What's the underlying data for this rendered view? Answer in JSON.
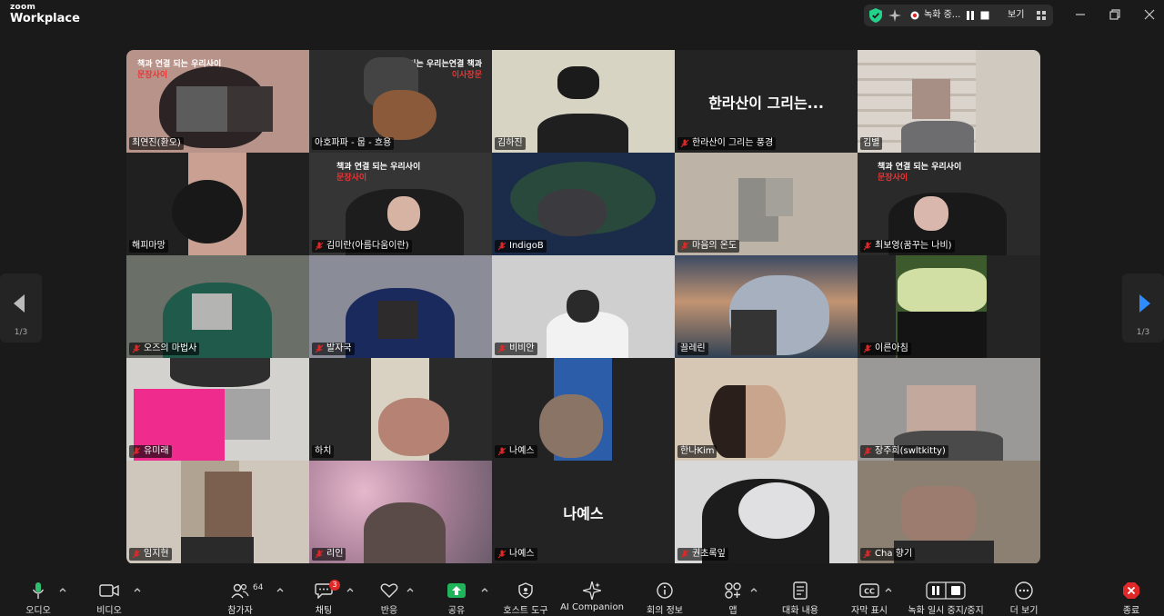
{
  "app": {
    "brand_small": "zoom",
    "brand_large": "Workplace"
  },
  "recording": {
    "status_text": "녹화 중...",
    "view_label": "보기"
  },
  "tiles": [
    {
      "name": "최연진(환오)",
      "muted": false,
      "bg": "#b8938a"
    },
    {
      "name": "아호파파 - 뭅 - 흐용",
      "muted": false,
      "bg": "#2c2c2c",
      "active": true
    },
    {
      "name": "김하진",
      "muted": false,
      "bg": "#d8d4c4"
    },
    {
      "name": "한라산이 그리는 풍경",
      "muted": true,
      "bg": "#232323",
      "big_label": "한라산이 그리는..."
    },
    {
      "name": "김별",
      "muted": false,
      "bg": "#cfc9c0"
    },
    {
      "name": "해피마망",
      "muted": false,
      "bg": "#202020"
    },
    {
      "name": "김미란(아름다움이란)",
      "muted": true,
      "bg": "#353535"
    },
    {
      "name": "IndigoB",
      "muted": true,
      "bg": "#1b2c4a"
    },
    {
      "name": "마음의 온도",
      "muted": true,
      "bg": "#bdb3a6"
    },
    {
      "name": "최보영(꿈꾸는 나비)",
      "muted": true,
      "bg": "#2a2a2a"
    },
    {
      "name": "오즈의 마법사",
      "muted": true,
      "bg": "#6a7068"
    },
    {
      "name": "발자국",
      "muted": true,
      "bg": "#8a8c98"
    },
    {
      "name": "비비안",
      "muted": true,
      "bg": "#cfcfcf"
    },
    {
      "name": "끌레린",
      "muted": false,
      "bg": "#5d7390"
    },
    {
      "name": "이른아침",
      "muted": true,
      "bg": "#242424"
    },
    {
      "name": "유미래",
      "muted": true,
      "bg": "#d4d2cf"
    },
    {
      "name": "하치",
      "muted": false,
      "bg": "#2a2a2a"
    },
    {
      "name": "나예스",
      "muted": true,
      "bg": "#232323"
    },
    {
      "name": "한나Kim",
      "muted": false,
      "bg": "#d6c6b4"
    },
    {
      "name": "장주희(swltkitty)",
      "muted": true,
      "bg": "#9b9997"
    },
    {
      "name": "임지현",
      "muted": true,
      "bg": "#cfc6bc"
    },
    {
      "name": "리인",
      "muted": true,
      "bg": "#b58fa4"
    },
    {
      "name": "나예스",
      "muted": true,
      "bg": "#232323",
      "big_label": "나예스"
    },
    {
      "name": "권초록잎",
      "muted": true,
      "bg": "#d8d8d8"
    },
    {
      "name": "Cha 향기",
      "muted": true,
      "bg": "#8c8073"
    }
  ],
  "posters": {
    "line1_a": "책과 연결",
    "line1_b": "되는 우리사이",
    "line2": "문장사이",
    "mirror1": "사이는 우리는연결 책과",
    "mirror2": "이사장문"
  },
  "paging": {
    "current": "1/3"
  },
  "toolbar": {
    "audio": "오디오",
    "video": "비디오",
    "participants": "참가자",
    "participants_count": "64",
    "chat": "채팅",
    "chat_badge": "3",
    "reactions": "반응",
    "share": "공유",
    "host_tools": "호스트 도구",
    "ai_companion": "AI Companion",
    "meeting_info": "회의 정보",
    "apps": "앱",
    "transcript": "대화 내용",
    "captions": "자막 표시",
    "recording_ctl": "녹화 일시 중지/중지",
    "more": "더 보기",
    "end": "종료"
  },
  "colors": {
    "accent_green": "#23d18b",
    "share_green": "#1fb35a",
    "end_red": "#e02828",
    "play_blue": "#2d8cff"
  }
}
